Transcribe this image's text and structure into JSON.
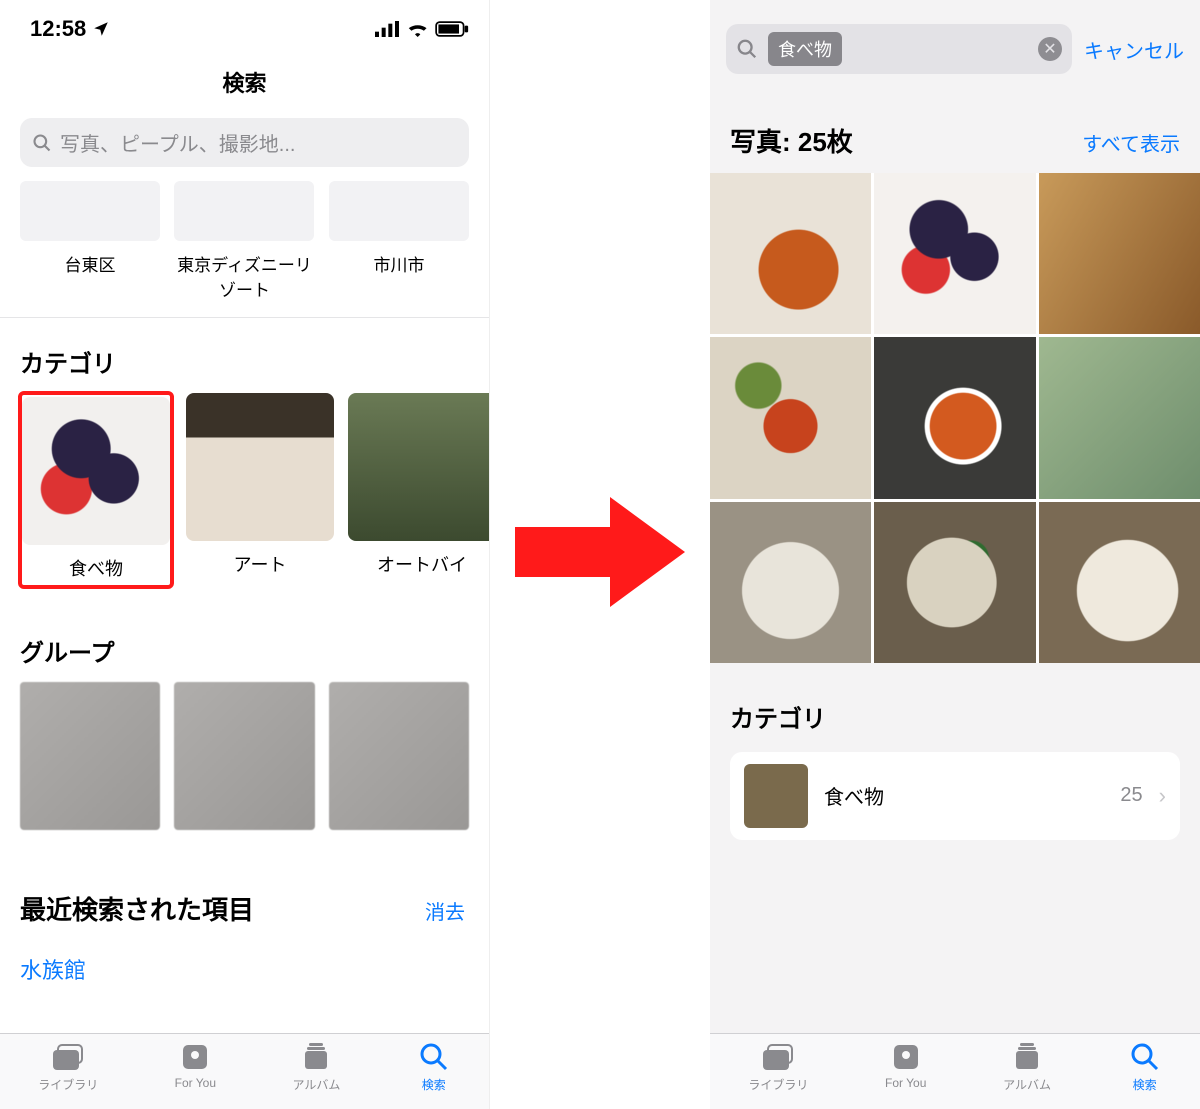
{
  "left": {
    "status": {
      "time": "12:58"
    },
    "title": "検索",
    "search_placeholder": "写真、ピープル、撮影地...",
    "locations": [
      "台東区",
      "東京ディズニーリゾート",
      "市川市"
    ],
    "category_header": "カテゴリ",
    "categories": [
      {
        "label": "食べ物"
      },
      {
        "label": "アート"
      },
      {
        "label": "オートバイ"
      }
    ],
    "group_header": "グループ",
    "recent_header": "最近検索された項目",
    "clear_label": "消去",
    "recent_items": [
      "水族館"
    ]
  },
  "right": {
    "search_chip": "食べ物",
    "cancel": "キャンセル",
    "results_label": "写真: 25枚",
    "show_all": "すべて表示",
    "category_header": "カテゴリ",
    "category_item": {
      "name": "食べ物",
      "count": "25"
    }
  },
  "tabs": {
    "library": "ライブラリ",
    "foryou": "For You",
    "album": "アルバム",
    "search": "検索"
  }
}
